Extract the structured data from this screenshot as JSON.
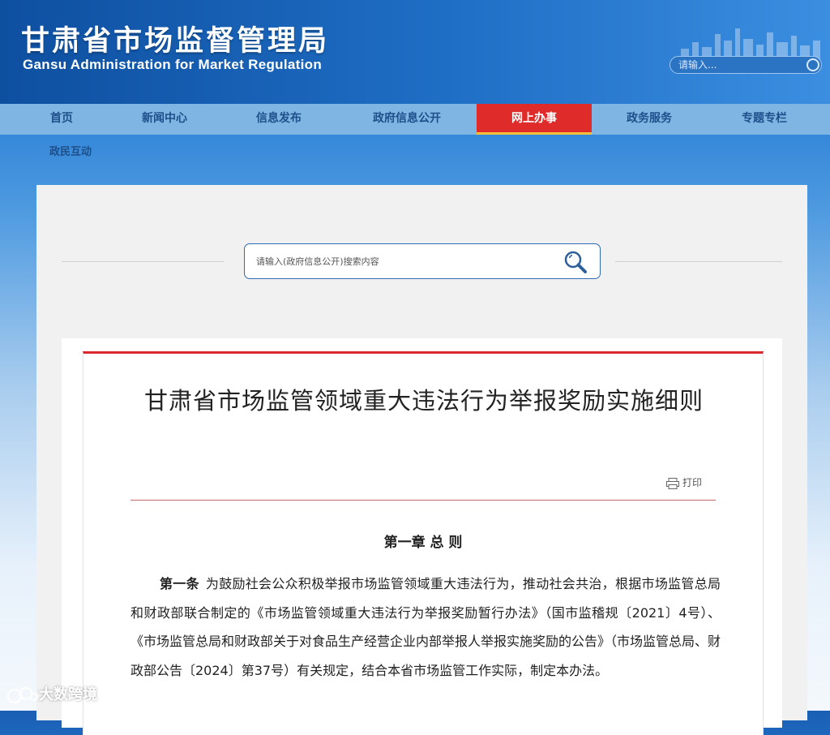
{
  "header": {
    "title": "甘肃省市场监督管理局",
    "subtitle": "Gansu Administration for Market Regulation",
    "search_placeholder": "请输入..."
  },
  "nav": {
    "items": [
      {
        "label": "首页"
      },
      {
        "label": "新闻中心"
      },
      {
        "label": "信息发布"
      },
      {
        "label": "政府信息公开"
      },
      {
        "label": "网上办事"
      },
      {
        "label": "政务服务"
      },
      {
        "label": "专题专栏"
      }
    ],
    "row2": "政民互动",
    "active_index": 4
  },
  "main_search": {
    "placeholder": "请输入(政府信息公开)搜索内容"
  },
  "article": {
    "title": "甘肃省市场监管领域重大违法行为举报奖励实施细则",
    "print_label": "打印",
    "chapter": "第一章 总 则",
    "lead": "第一条",
    "body": "为鼓励社会公众积极举报市场监管领域重大违法行为，推动社会共治，根据市场监管总局和财政部联合制定的《市场监管领域重大违法行为举报奖励暂行办法》（国市监稽规〔2021〕4号）、《市场监管总局和财政部关于对食品生产经营企业内部举报人举报实施奖励的公告》（市场监管总局、财政部公告〔2024〕第37号）有关规定，结合本省市场监管工作实际，制定本办法。"
  },
  "watermark": "大数跨境",
  "colors": {
    "header_blue": "#1f6fc6",
    "nav_bg": "#7fb5e3",
    "nav_active": "#e02b2b",
    "accent_red": "#d9282f"
  }
}
